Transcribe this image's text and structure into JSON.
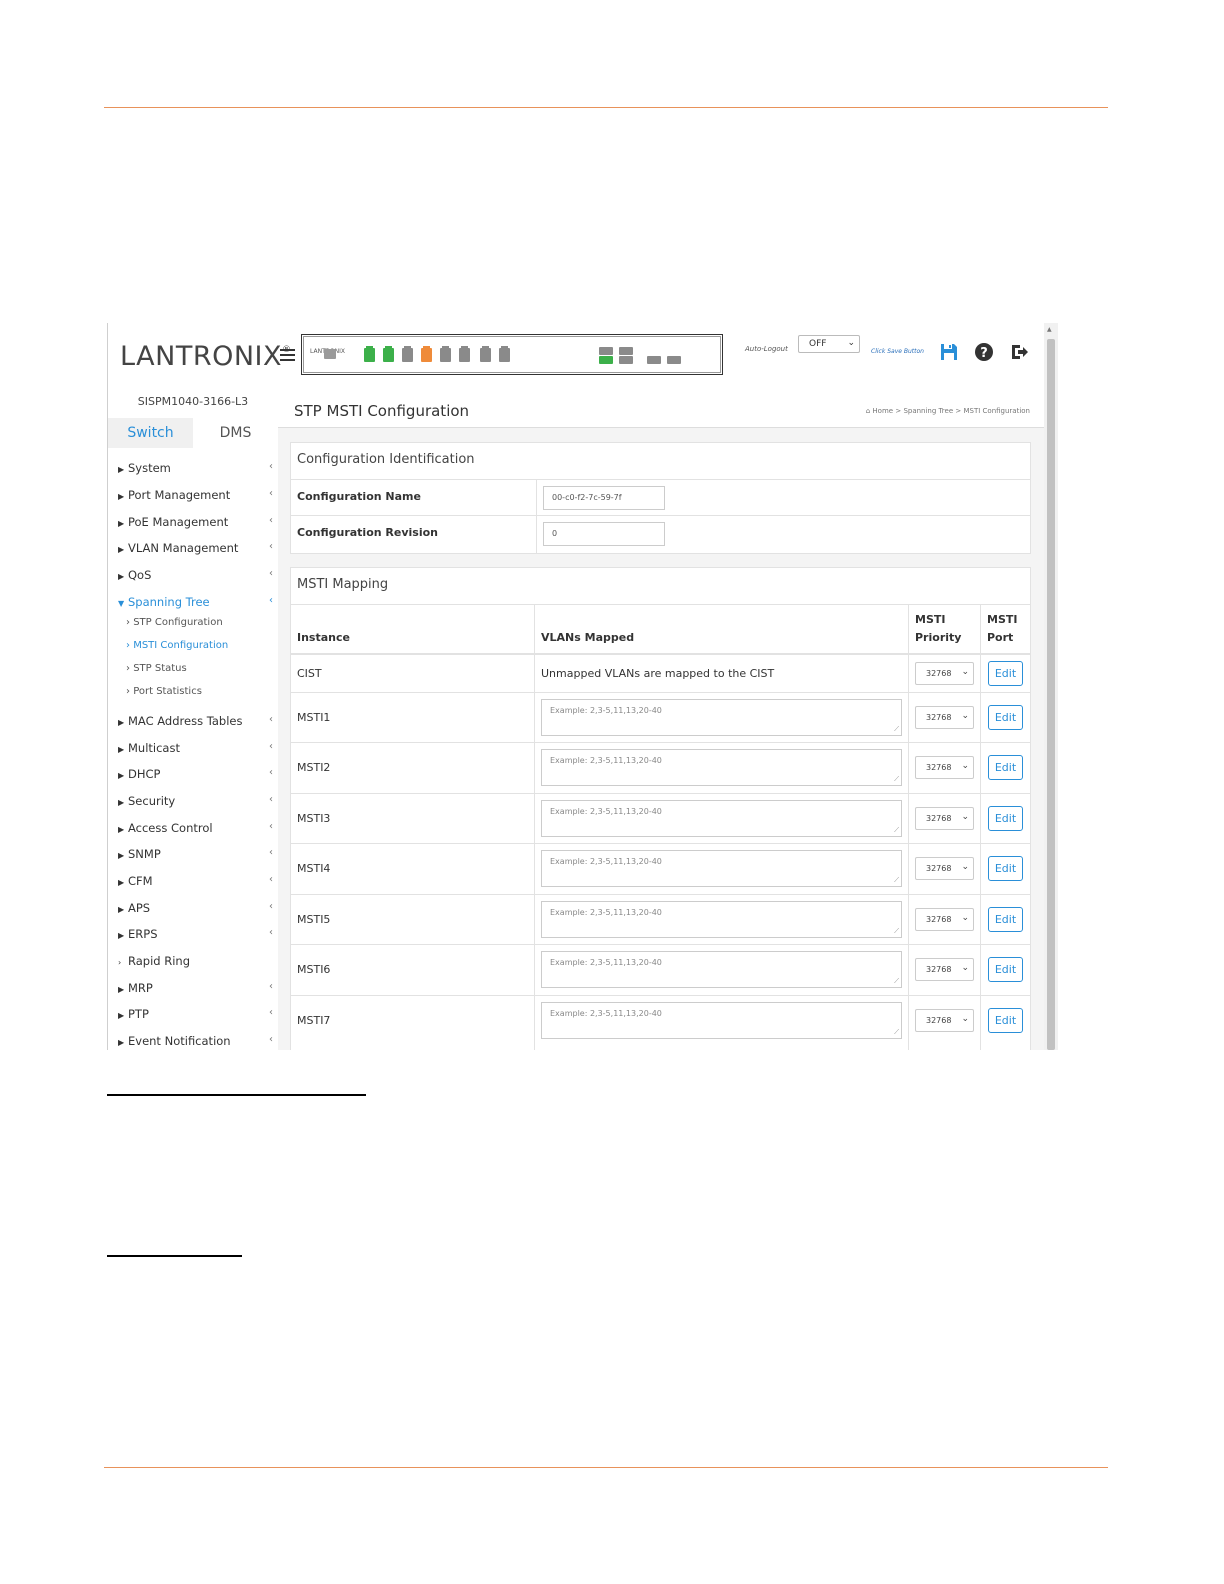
{
  "header": {
    "logo_text": "LANTRONIX",
    "logo_mark": "®",
    "panel_logo": "LANTRONIX",
    "auto_logout_label": "Auto-Logout",
    "auto_logout_value": "OFF",
    "save_hint": "Click Save Button",
    "icons": [
      "save-icon",
      "help-icon",
      "logout-icon"
    ]
  },
  "sidebar": {
    "device_name": "SISPM1040-3166-L3",
    "tabs": [
      {
        "label": "Switch",
        "active": true
      },
      {
        "label": "DMS",
        "active": false
      }
    ],
    "items": [
      {
        "label": "System"
      },
      {
        "label": "Port Management"
      },
      {
        "label": "PoE Management"
      },
      {
        "label": "VLAN Management"
      },
      {
        "label": "QoS"
      },
      {
        "label": "Spanning Tree",
        "active": true
      },
      {
        "label": "MAC Address Tables"
      },
      {
        "label": "Multicast"
      },
      {
        "label": "DHCP"
      },
      {
        "label": "Security"
      },
      {
        "label": "Access Control"
      },
      {
        "label": "SNMP"
      },
      {
        "label": "CFM"
      },
      {
        "label": "APS"
      },
      {
        "label": "ERPS"
      },
      {
        "label": "Rapid Ring"
      },
      {
        "label": "MRP"
      },
      {
        "label": "PTP"
      },
      {
        "label": "Event Notification"
      }
    ],
    "sub_items": [
      {
        "label": "STP Configuration"
      },
      {
        "label": "MSTI Configuration",
        "active": true
      },
      {
        "label": "STP Status"
      },
      {
        "label": "Port Statistics"
      }
    ]
  },
  "page": {
    "title": "STP MSTI Configuration",
    "breadcrumb": [
      "Home",
      "Spanning Tree",
      "MSTI Configuration"
    ],
    "breadcrumb_sep": ">"
  },
  "config_identification": {
    "title": "Configuration Identification",
    "name_label": "Configuration Name",
    "name_value": "00-c0-f2-7c-59-7f",
    "revision_label": "Configuration Revision",
    "revision_value": "0"
  },
  "msti_mapping": {
    "title": "MSTI Mapping",
    "headers": {
      "instance": "Instance",
      "vlans": "VLANs Mapped",
      "priority": "MSTI Priority",
      "port": "MSTI Port"
    },
    "cist_text": "Unmapped VLANs are mapped to the CIST",
    "placeholder": "Example: 2,3-5,11,13,20-40",
    "edit_label": "Edit",
    "rows": [
      {
        "instance": "CIST",
        "priority": "32768"
      },
      {
        "instance": "MSTI1",
        "priority": "32768"
      },
      {
        "instance": "MSTI2",
        "priority": "32768"
      },
      {
        "instance": "MSTI3",
        "priority": "32768"
      },
      {
        "instance": "MSTI4",
        "priority": "32768"
      },
      {
        "instance": "MSTI5",
        "priority": "32768"
      },
      {
        "instance": "MSTI6",
        "priority": "32768"
      },
      {
        "instance": "MSTI7",
        "priority": "32768"
      }
    ]
  },
  "colors": {
    "accent": "#2a8fd8",
    "rule": "#e8925a",
    "port_green": "#3cb04a",
    "port_orange": "#ef8b3a"
  }
}
